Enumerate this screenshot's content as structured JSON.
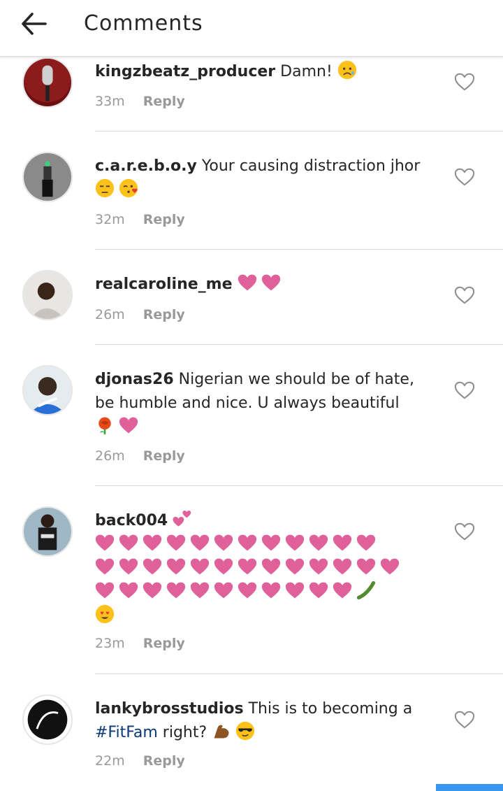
{
  "header": {
    "title": "Comments",
    "back_icon": "arrow-left-icon"
  },
  "colors": {
    "hashtag": "#0b3a75",
    "heart_emoji": "#e0609a",
    "reply_link": "#999999",
    "bottom_accent": "#3897f0"
  },
  "comments": [
    {
      "username": "kingzbeatz_producer",
      "text": "Damn!",
      "emojis": [
        "disappointed-face-emoji"
      ],
      "time": "33m",
      "reply_label": "Reply"
    },
    {
      "username": "c.a.r.e.b.o.y",
      "text": "Your causing distraction jhor",
      "emojis": [
        "unamused-face-emoji",
        "kissing-face-emoji"
      ],
      "time": "32m",
      "reply_label": "Reply"
    },
    {
      "username": "realcaroline_me",
      "text": "",
      "emojis": [
        "heart-emoji",
        "heart-emoji"
      ],
      "time": "26m",
      "reply_label": "Reply"
    },
    {
      "username": "djonas26",
      "text": "Nigerian we should be of hate, be humble and nice. U always beautiful",
      "emojis": [
        "rose-emoji",
        "heart-emoji"
      ],
      "time": "26m",
      "reply_label": "Reply"
    },
    {
      "username": "back004",
      "text": "",
      "emojis": [
        "two-hearts-emoji",
        "heart-emoji x 35",
        "cucumber-emoji",
        "heart-eyes-emoji"
      ],
      "time": "23m",
      "reply_label": "Reply"
    },
    {
      "username": "lankybrosstudios",
      "text": "This is to becoming a",
      "hashtag": "#FitFam",
      "text_after": "right?",
      "emojis": [
        "flexed-biceps-emoji",
        "sunglasses-face-emoji"
      ],
      "time": "22m",
      "reply_label": "Reply"
    }
  ]
}
